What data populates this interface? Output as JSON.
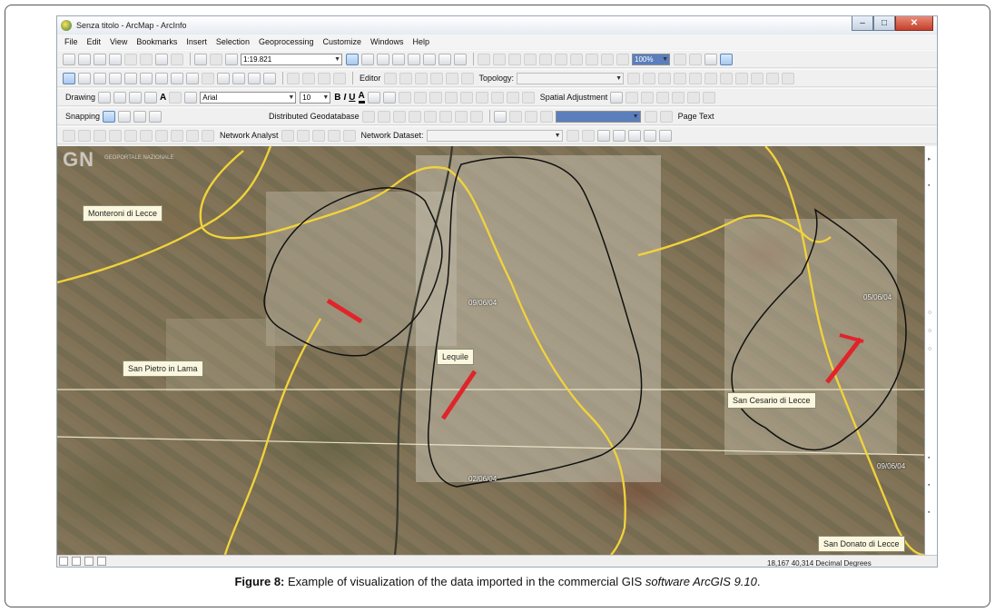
{
  "window": {
    "title": "Senza titolo - ArcMap - ArcInfo",
    "controls": [
      "–",
      "□",
      "✕"
    ]
  },
  "menu": [
    "File",
    "Edit",
    "View",
    "Bookmarks",
    "Insert",
    "Selection",
    "Geoprocessing",
    "Customize",
    "Windows",
    "Help"
  ],
  "toolbar_standard": {
    "scale_value": "1:19.821",
    "zoom_value": "100%"
  },
  "toolbar_tools": {
    "editor_label": "Editor",
    "topology_label": "Topology:"
  },
  "toolbar_draw": {
    "drawing_label": "Drawing",
    "font_name": "Arial",
    "font_size": "10",
    "bold": "B",
    "italic": "I",
    "underline": "U",
    "font_color_glyph": "A",
    "spatial_adjustment_label": "Spatial Adjustment"
  },
  "toolbar_snapping": {
    "snapping_label": "Snapping",
    "distributed_gdb_label": "Distributed Geodatabase",
    "page_text_label": "Page Text"
  },
  "toolbar_network": {
    "network_analyst_label": "Network Analyst",
    "network_dataset_label": "Network Dataset:"
  },
  "map": {
    "watermark": "GN",
    "watermark_sub": "GEOPORTALE NAZIONALE",
    "labels": {
      "monteroni": "Monteroni di Lecce",
      "san_pietro": "San Pietro in Lama",
      "lequile": "Lequile",
      "san_cesario": "San Cesario di Lecce",
      "san_donato": "San Donato di Lecce"
    },
    "dates": {
      "d1": "09/06/04",
      "d2": "05/06/04",
      "d3": "09/06/04",
      "d4": "02/06/04"
    },
    "colors": {
      "boundary_yellow": "#f2d33a",
      "outline_black": "#111111",
      "road_red": "#e0242b"
    }
  },
  "status": {
    "coordinates": "18,167  40,314 Decimal Degrees"
  },
  "caption": {
    "prefix": "Figure 8:",
    "text": " Example of visualization of the data imported in the commercial GIS ",
    "italic": "software ArcGIS  9.10",
    "suffix": "."
  }
}
